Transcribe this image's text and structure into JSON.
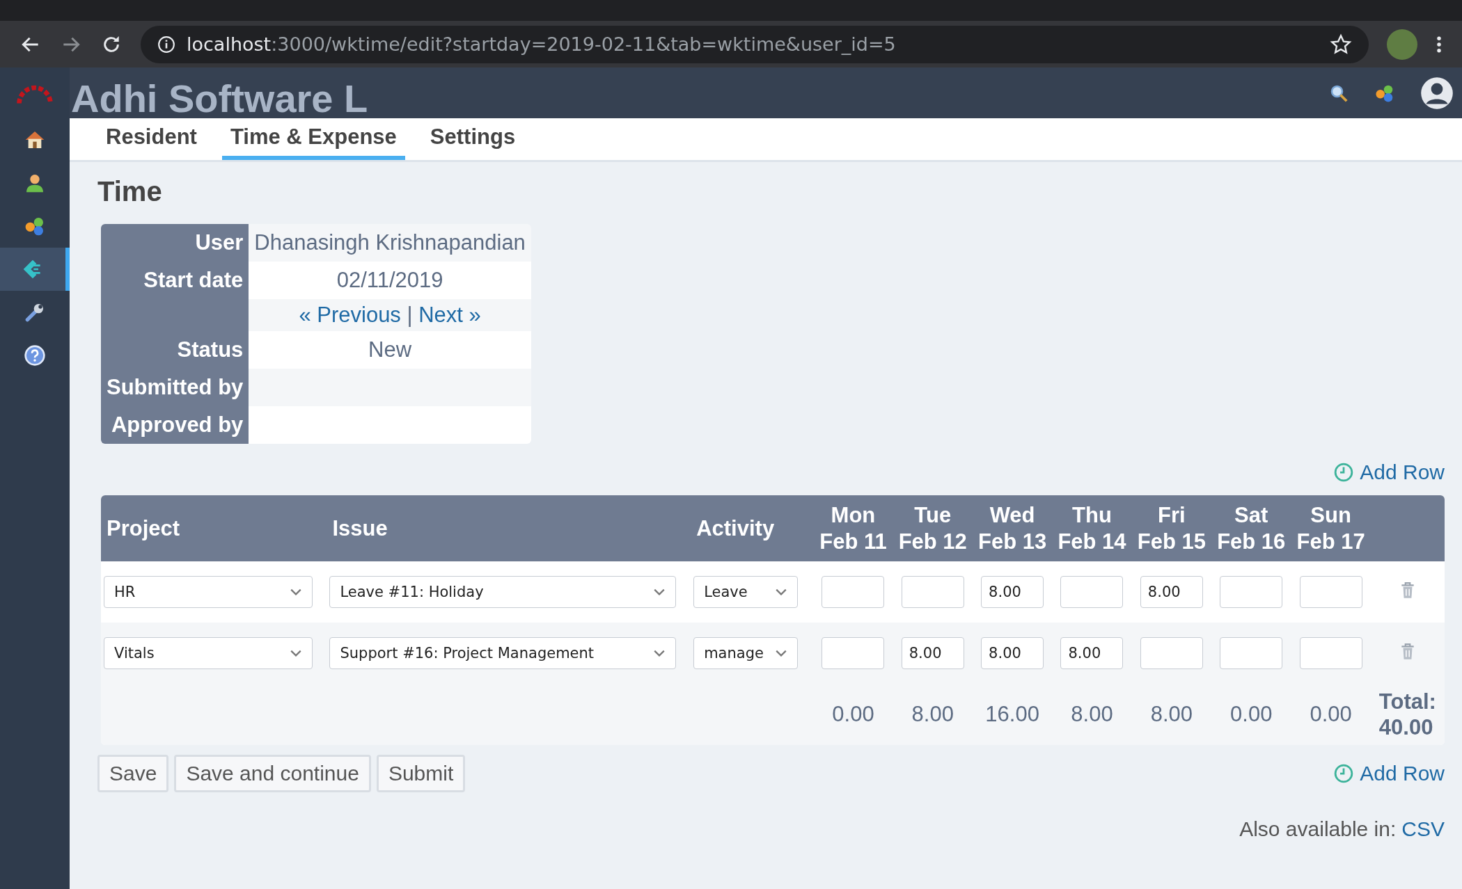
{
  "browser": {
    "url_host": "localhost",
    "url_rest": ":3000/wktime/edit?startday=2019-02-11&tab=wktime&user_id=5"
  },
  "app": {
    "title": "Adhi Software L"
  },
  "sidebar": {
    "items": [
      {
        "kind": "home",
        "selected": false
      },
      {
        "kind": "person",
        "selected": false
      },
      {
        "kind": "circles",
        "selected": false
      },
      {
        "kind": "timesheet",
        "selected": true
      },
      {
        "kind": "wrench",
        "selected": false
      },
      {
        "kind": "help",
        "selected": false
      }
    ]
  },
  "tabs": [
    {
      "label": "Resident",
      "selected": false
    },
    {
      "label": "Time & Expense",
      "selected": true
    },
    {
      "label": "Settings",
      "selected": false
    }
  ],
  "page_title": "Time",
  "info": [
    {
      "kind": "text",
      "label": "User",
      "value": "Dhanasingh Krishnapandian"
    },
    {
      "kind": "text",
      "label": "Start date",
      "value": "02/11/2019"
    },
    {
      "kind": "nav",
      "previous": "« Previous",
      "separator": "|",
      "next": "Next »"
    },
    {
      "kind": "text",
      "label": "Status",
      "value": "New"
    },
    {
      "kind": "text",
      "label": "Submitted by"
    },
    {
      "kind": "text",
      "label": "Approved by"
    }
  ],
  "add_row_links": [
    "Add Row",
    "Add Row"
  ],
  "grid": {
    "columns": {
      "project": "Project",
      "issue": "Issue",
      "activity": "Activity"
    },
    "days": [
      {
        "day": "Mon",
        "date": "Feb 11"
      },
      {
        "day": "Tue",
        "date": "Feb 12"
      },
      {
        "day": "Wed",
        "date": "Feb 13"
      },
      {
        "day": "Thu",
        "date": "Feb 14"
      },
      {
        "day": "Fri",
        "date": "Feb 15"
      },
      {
        "day": "Sat",
        "date": "Feb 16"
      },
      {
        "day": "Sun",
        "date": "Feb 17"
      }
    ],
    "rows": [
      {
        "project": "HR",
        "issue": "Leave #11: Holiday",
        "activity": "Leave",
        "hours": {
          "2": "8.00",
          "4": "8.00"
        }
      },
      {
        "project": "Vitals",
        "issue": "Support #16: Project Management",
        "activity": "manage",
        "hours": {
          "1": "8.00",
          "2": "8.00",
          "3": "8.00"
        }
      }
    ],
    "totals": [
      "0.00",
      "8.00",
      "16.00",
      "8.00",
      "8.00",
      "0.00",
      "0.00"
    ],
    "total_label": "Total:",
    "total": "40.00"
  },
  "buttons": [
    "Save",
    "Save and continue",
    "Submit"
  ],
  "footer": {
    "text": "Also available in:",
    "link": "CSV"
  }
}
